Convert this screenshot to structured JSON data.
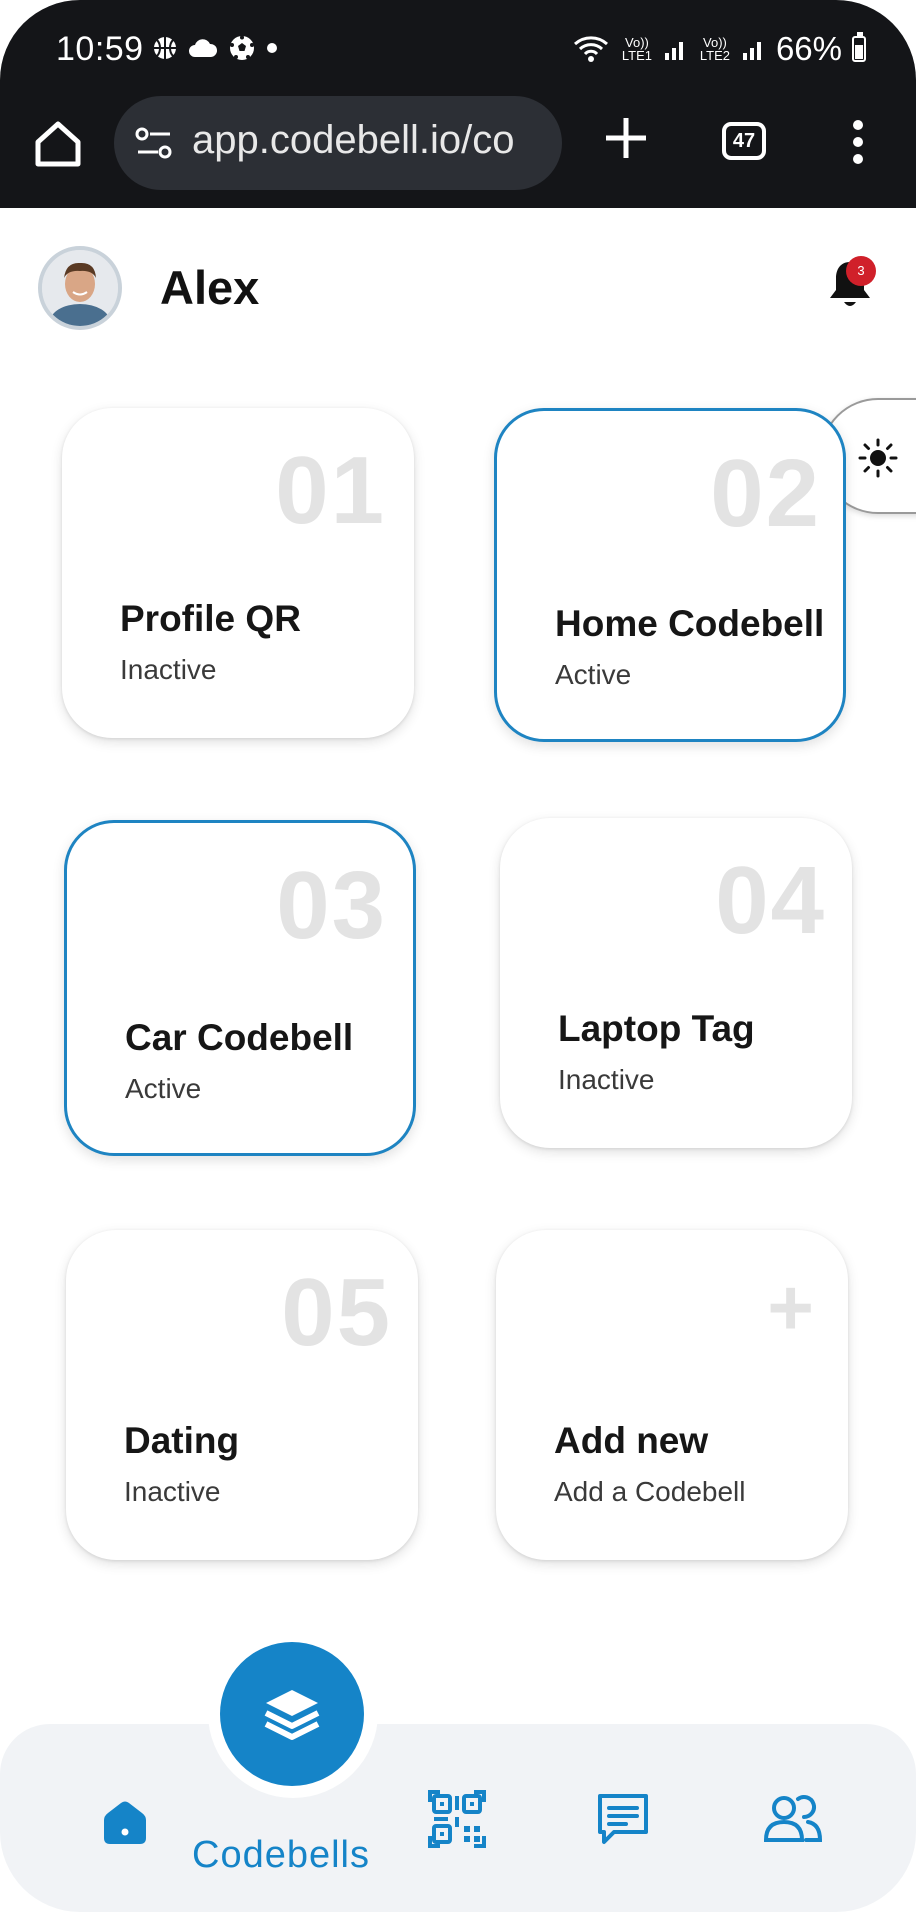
{
  "status_bar": {
    "time": "10:59",
    "battery": "66%",
    "sim1": "Vo)) LTE1",
    "sim2": "Vo)) LTE2"
  },
  "browser": {
    "url": "app.codebell.io/co",
    "tab_count": "47"
  },
  "header": {
    "username": "Alex",
    "notification_count": "3"
  },
  "cards": [
    {
      "number": "01",
      "title": "Profile QR",
      "status": "Inactive",
      "active": false
    },
    {
      "number": "02",
      "title": "Home Codebell",
      "status": "Active",
      "active": true
    },
    {
      "number": "03",
      "title": "Car Codebell",
      "status": "Active",
      "active": true
    },
    {
      "number": "04",
      "title": "Laptop Tag",
      "status": "Inactive",
      "active": false
    },
    {
      "number": "05",
      "title": "Dating",
      "status": "Inactive",
      "active": false
    }
  ],
  "add_card": {
    "symbol": "+",
    "title": "Add new",
    "subtitle": "Add a Codebell"
  },
  "bottom_nav": {
    "active_label": "Codebells",
    "items": [
      "home-icon",
      "layers-icon",
      "qr-code-icon",
      "chat-icon",
      "people-icon"
    ]
  },
  "colors": {
    "accent": "#1584c8",
    "active_border": "#1e84c2",
    "badge": "#d0202a"
  }
}
